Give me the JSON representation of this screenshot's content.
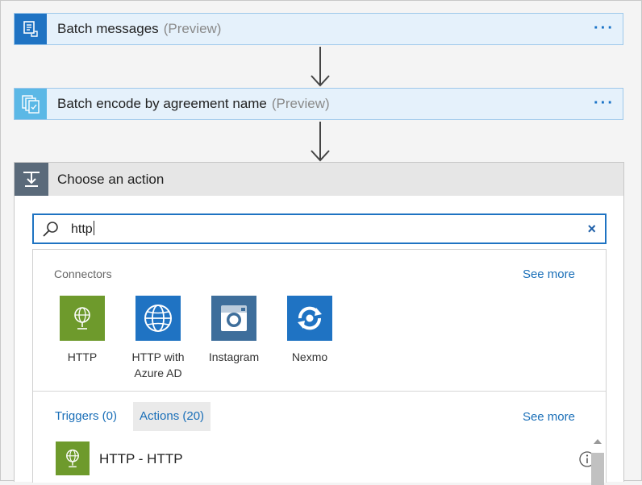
{
  "steps": [
    {
      "title": "Batch messages",
      "preview": "(Preview)",
      "menu": "···"
    },
    {
      "title": "Batch encode by agreement name",
      "preview": "(Preview)",
      "menu": "···"
    }
  ],
  "action": {
    "title": "Choose an action",
    "search_value": "http",
    "clear_label": "×"
  },
  "connectors": {
    "label": "Connectors",
    "see_more": "See more",
    "items": [
      {
        "label_line1": "HTTP",
        "label_line2": "",
        "icon": "http-globe-icon",
        "color": "#6e9a2c"
      },
      {
        "label_line1": "HTTP with",
        "label_line2": "Azure AD",
        "icon": "globe-icon",
        "color": "#1f73c3"
      },
      {
        "label_line1": "Instagram",
        "label_line2": "",
        "icon": "camera-icon",
        "color": "#3e6e9b"
      },
      {
        "label_line1": "Nexmo",
        "label_line2": "",
        "icon": "nexmo-icon",
        "color": "#1f73c3"
      }
    ]
  },
  "tabs": {
    "triggers": "Triggers (0)",
    "actions": "Actions (20)",
    "see_more": "See more"
  },
  "results": [
    {
      "label": "HTTP - HTTP",
      "icon": "http-globe-icon"
    }
  ],
  "colors": {
    "accent": "#1e73c2",
    "step_bg": "#e5f1fb",
    "http_green": "#6e9a2c"
  }
}
